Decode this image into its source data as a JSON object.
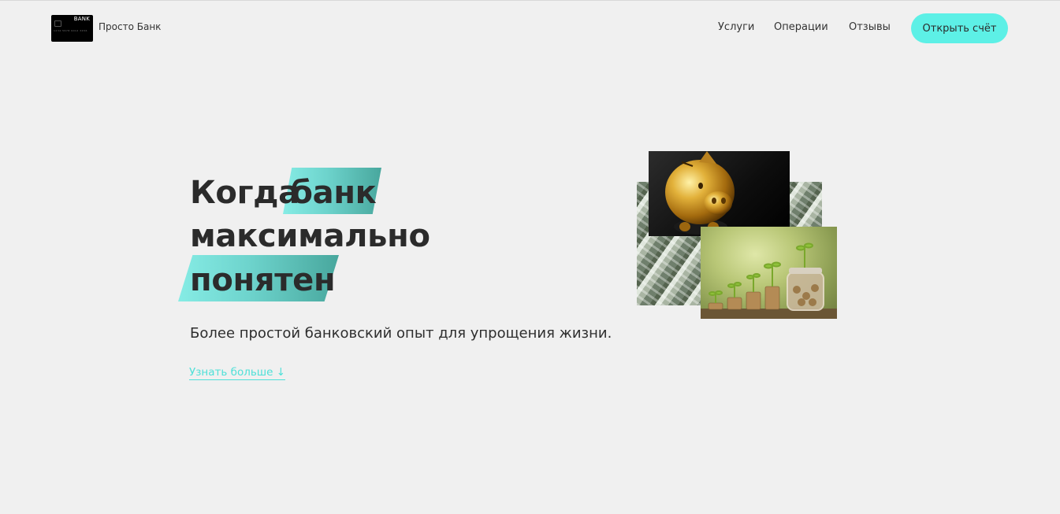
{
  "header": {
    "logo": {
      "card_text": "BANK",
      "card_number": "1234 5678 9012 3456"
    },
    "brand_name": "Просто Банк",
    "nav": [
      {
        "label": "Услуги"
      },
      {
        "label": "Операции"
      },
      {
        "label": "Отзывы"
      }
    ],
    "cta_label": "Открыть счёт"
  },
  "hero": {
    "title_parts": {
      "word1": "Когда",
      "word2": "банк",
      "word3": "максимально",
      "word4": "понятен"
    },
    "subtitle": "Более простой банковский опыт для упрощения жизни.",
    "learn_more": "Узнать больше ↓"
  },
  "colors": {
    "background": "#f0f0f0",
    "accent": "#5df0e6",
    "highlight_start": "#86ece5",
    "highlight_end": "#48a79d",
    "text": "#2b2b2b"
  },
  "images": {
    "money_stack": "dollar-bills-photo",
    "piggy_bank": "gold-piggy-bank-photo",
    "coin_plants": "coins-with-sprouts-photo"
  }
}
